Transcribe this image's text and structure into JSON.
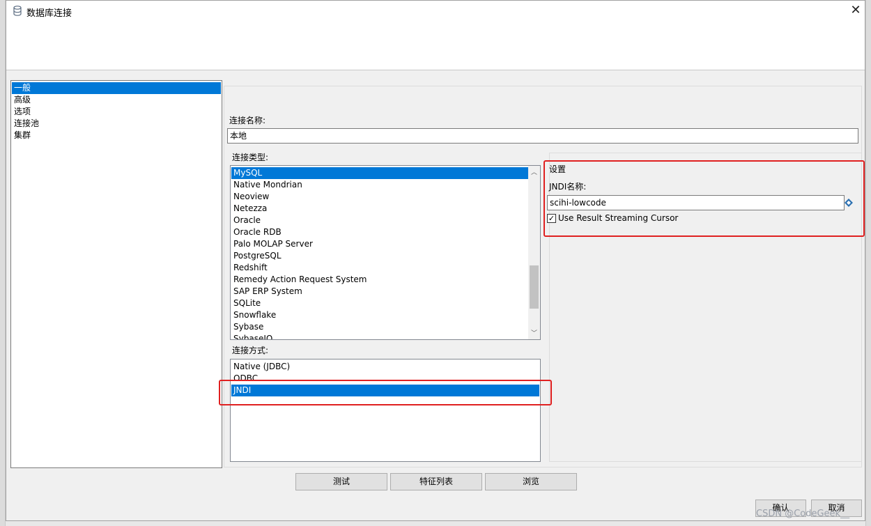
{
  "window": {
    "title": "数据库连接",
    "close_glyph": "✕"
  },
  "nav": {
    "items": [
      {
        "label": "一般",
        "selected": true
      },
      {
        "label": "高级",
        "selected": false
      },
      {
        "label": "选项",
        "selected": false
      },
      {
        "label": "连接池",
        "selected": false
      },
      {
        "label": "集群",
        "selected": false
      }
    ]
  },
  "general": {
    "connection_name_label": "连接名称:",
    "connection_name_value": "本地",
    "connection_type_label": "连接类型:",
    "connection_types": [
      {
        "label": "MySQL",
        "selected": true
      },
      {
        "label": "Native Mondrian",
        "selected": false
      },
      {
        "label": "Neoview",
        "selected": false
      },
      {
        "label": "Netezza",
        "selected": false
      },
      {
        "label": "Oracle",
        "selected": false
      },
      {
        "label": "Oracle RDB",
        "selected": false
      },
      {
        "label": "Palo MOLAP Server",
        "selected": false
      },
      {
        "label": "PostgreSQL",
        "selected": false
      },
      {
        "label": "Redshift",
        "selected": false
      },
      {
        "label": "Remedy Action Request System",
        "selected": false
      },
      {
        "label": "SAP ERP System",
        "selected": false
      },
      {
        "label": "SQLite",
        "selected": false
      },
      {
        "label": "Snowflake",
        "selected": false
      },
      {
        "label": "Sybase",
        "selected": false
      },
      {
        "label": "SybaseIQ",
        "selected": false
      }
    ],
    "access_label": "连接方式:",
    "access_methods": [
      {
        "label": "Native (JDBC)",
        "selected": false
      },
      {
        "label": "ODBC",
        "selected": false
      },
      {
        "label": "JNDI",
        "selected": true
      }
    ]
  },
  "settings": {
    "title": "设置",
    "jndi_label": "JNDI名称:",
    "jndi_value": "scihi-lowcode",
    "streaming_label": "Use Result Streaming Cursor",
    "streaming_checked": true,
    "check_glyph": "✓"
  },
  "buttons": {
    "test": "测试",
    "features": "特征列表",
    "explore": "浏览",
    "ok": "确认",
    "cancel": "取消"
  },
  "watermark": "CSDN @CodeGeek__",
  "colors": {
    "selection": "#0078d7",
    "highlight_box": "#e02020"
  }
}
